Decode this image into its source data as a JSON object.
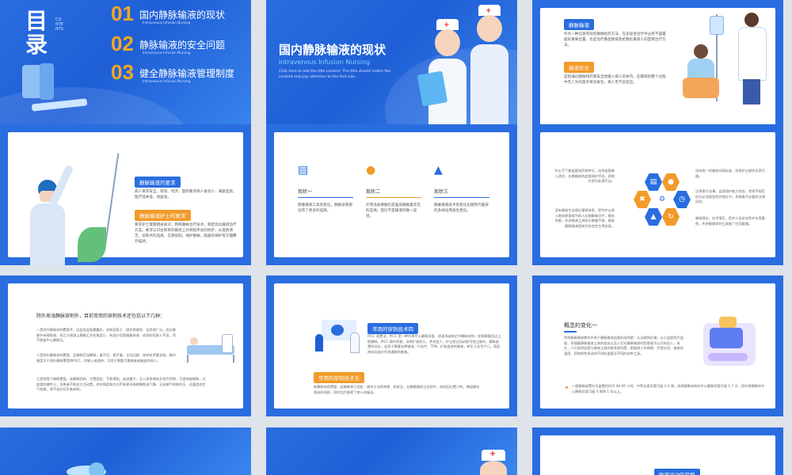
{
  "s1": {
    "title": "目录",
    "contents": "CONTENTS",
    "items": [
      {
        "num": "01",
        "title": "国内静脉输液的现状",
        "sub": "Intravenous Infusion Nursing"
      },
      {
        "num": "02",
        "title": "静脉输液的安全问题",
        "sub": "Intravenous Infusion Nursing"
      },
      {
        "num": "03",
        "title": "健全静脉输液管理制度",
        "sub": "Intravenous Infusion Nursing"
      }
    ]
  },
  "s2": {
    "title": "国内静脉输液的现状",
    "sub": "Intravenous Infusion Nursing",
    "desc": "Click here to add the title content. The title should match the content and pay attention to the font size."
  },
  "s3": {
    "tag1": "静脉输液",
    "text1": "作为一种迅速有效的静脉给药方法，在多途径治疗中占有不容置疑的重要位置，也是治疗重症疾病及抢救危重病人的首用治疗方法。",
    "tag2": "输液安全",
    "text2": "是指通过静脉将药液安全地输入病人的体内，在输液的整个过程中无人为的意外情况发生，病人无不良反应。"
  },
  "s4": {
    "tag1": "静脉输液的要求",
    "text1": "病人要求安全、有效、经济、医院要求病人投诉少、满意度高、医疗成本低、效益高。",
    "tag2": "静脉输液护士的要求",
    "text2": "要求护士掌握相关知识，熟练静脉治疗技术，制定优化输液治疗方案。要求认识古筒草的输液上升到程序化的地步，从提防清洁，穿刺点的选择，实施穿刺，保护静脉，随喜的保护等方面腾开描述。"
  },
  "s5": {
    "cols": [
      {
        "icon": "clipboard-icon",
        "label": "现状一",
        "text": "随着输液工具的变化，静脉穿刺部位有了更多的选择。"
      },
      {
        "icon": "people-icon",
        "label": "现状二",
        "text": "外周浅表静脉仍是临床静脉最常见的选择，但已不是输液的唯一途径。"
      },
      {
        "icon": "chart-icon",
        "label": "现状三",
        "text": "静脉输液技术的变化也随现代临床的多样化而发生变化。"
      }
    ]
  },
  "s6": {
    "lt": "护士不了解血管和药物特点，选择血管输入途径，长期输液的血管保护手段，药物外渗后处理不当。",
    "lb": "没有输液专业理论课程体系，受传护士接入临床就直接为病人实施静脉治疗，服务控制，先进输液工具知识掌握不够，临床静脉输液相关并发症发生率较高。",
    "rt": "没有统一的输液实践标准，导致护士操作无章可循。",
    "rm": "注律意识淡薄，自我保护能力较低，常常不规范执行必须规定的护理文书，多数看不必要的法律风险。",
    "rb": "输液理念、技术落后，医护人员安全防护未受重视，先进静脉穿刺工具推广应用缓慢。"
  },
  "s7": {
    "heading": "除外周浅静脉穿刺外，目前常用的穿刺技术还包括以下几种：",
    "p1": "一是颈外静脉穿刺置管术，因此处血管暴露好，穿刺容易于、操作简便易、适用颈广泛。但在静脉外有碍视线，如之与颈部上静脉汇合处角度小，有部分导管随着体液、成续较搭接入不深，而不能留中心静脉压。",
    "p2": "二是颈内静脉穿刺置管，此静脉范深静脉，着手后，操不着，全位回顾，穿刺技术要求高。操作难度大于颈外静脉置管和PICC，但输入液速快，可用于需要大量输液或输血的病人。",
    "p3": "三是锁骨下静脉置管，该静脉固的、位置固定，不易塌陷，血流量大，注入高渗液体及化疗药物，可很快被稀释，对血管刺激性小，但患者不能自主活动置，进针角度和方向不准易导致输胸腔或气胸，又因输气的操作压，还要造成空气栓塞，易不适应初学者穿刺。"
  },
  "s8": {
    "tag1": "常用的穿刺技术四",
    "text1": "PICC 留置法，PICC 是一种外周中心静脉导管，经表浅或前近中静脉穿刺，经贵静脉回达上腔静脉。PICC 操作简便，穿刺扩展性小，并发症少，护士经过培训即可独立操作，静脉留置时间长，适用于需要长期输液、行化疗、TPN、扩新血液的患者，新生儿及早产儿，家庭病床及缺乏外周通路的患者。",
    "tag2": "常用的穿刺技术五",
    "text2": "新静脉穿刺置管，此静脉易于固定，操作方法简单便、较安全，在腋静脉前过全程中，穿刺回位置少刺，增加康在感染的同致，同时加大操索了病人的痛苦。"
  },
  "s9": {
    "heading": "概念的变化一",
    "text": "传统静脉输液教学中关于静脉输液血管的选择是：从远端到近端，从小血管到大血管。但随着静脉输液工具的变化以及人们对静脉输液的危害意识认识的深入，现在，人们选择血管与输液工具的基本原则是：根据病人的病情、疗程长短、输液的速度、药物的性质选择不同的血管及不同的穿刺工具。",
    "bullet": "一般静脉留置针可留置时间为 48-96 小时，中等长度导管可留 2-4 周，经周静脉穿刺的中心静脉导管可留 1-7 天，经外周静脉的中心静脉导管可留 4 周到 1 年以上。"
  },
  "s12": {
    "tag": "输液运动的趋势"
  }
}
